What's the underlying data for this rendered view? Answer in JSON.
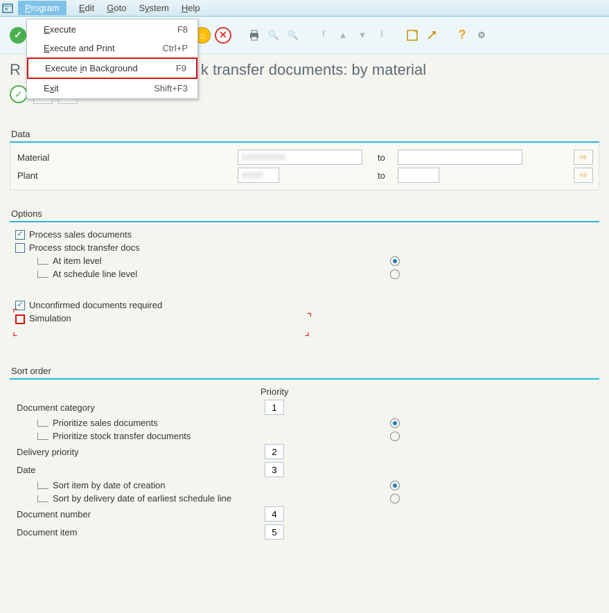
{
  "menubar": {
    "program": "Program",
    "edit": "Edit",
    "goto": "Goto",
    "system": "System",
    "help": "Help"
  },
  "dropdown": {
    "items": [
      {
        "label": "Execute",
        "shortcut": "F8",
        "ul": "E"
      },
      {
        "label": "Execute and Print",
        "shortcut": "Ctrl+P",
        "ul": "E"
      },
      {
        "label": "Execute in Background",
        "shortcut": "F9",
        "ul": "i"
      },
      {
        "label": "Exit",
        "shortcut": "Shift+F3",
        "ul": "x"
      }
    ]
  },
  "page_title": "transfer documents: by material",
  "page_title_prefix": "R",
  "data": {
    "group_label": "Data",
    "material_label": "Material",
    "plant_label": "Plant",
    "material_from": "XXXXXXXX",
    "material_to_label": "to",
    "material_to": "",
    "plant_from": "XXXX",
    "plant_to_label": "to",
    "plant_to": ""
  },
  "options": {
    "group_label": "Options",
    "process_sales": "Process sales documents",
    "process_stock": "Process stock transfer docs",
    "item_level": "At item level",
    "schedule_level": "At schedule line level",
    "unconfirmed": "Unconfirmed documents required",
    "simulation": "Simulation"
  },
  "sort": {
    "group_label": "Sort order",
    "priority_header": "Priority",
    "doc_category": "Document category",
    "prio_sales": "Prioritize sales documents",
    "prio_stock": "Prioritize stock transfer documents",
    "delivery_prio": "Delivery priority",
    "date": "Date",
    "sort_creation": "Sort item by date of creation",
    "sort_delivery": "Sort by delivery date of earliest schedule line",
    "doc_number": "Document number",
    "doc_item": "Document item",
    "values": {
      "category": "1",
      "delivery": "2",
      "date": "3",
      "number": "4",
      "item": "5"
    }
  }
}
